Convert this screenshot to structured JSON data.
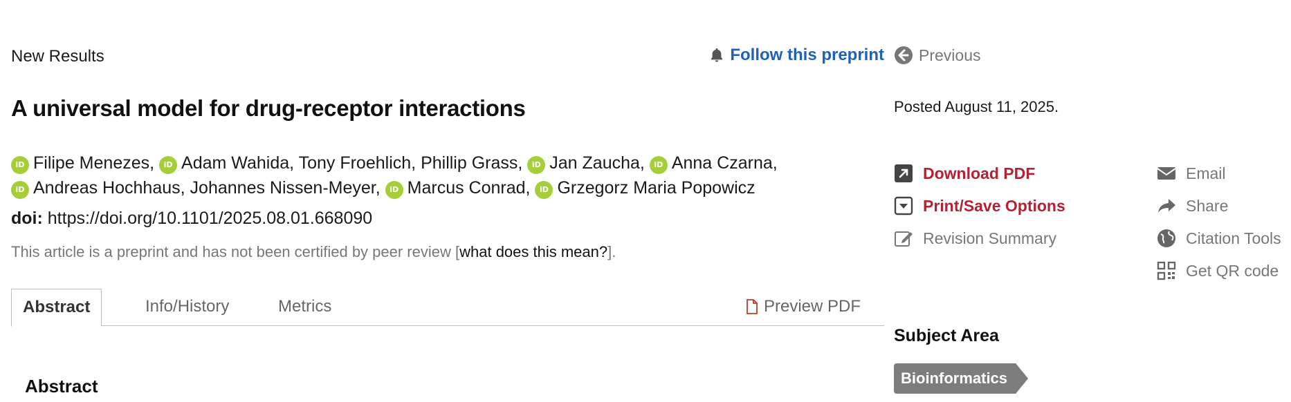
{
  "article": {
    "section_label": "New Results",
    "follow_label": "Follow this preprint",
    "title": "A universal model for drug-receptor interactions",
    "authors": [
      {
        "name": "Filipe Menezes,",
        "orcid": true
      },
      {
        "name": "Adam Wahida,",
        "orcid": true
      },
      {
        "name": "Tony Froehlich,",
        "orcid": false
      },
      {
        "name": "Phillip Grass,",
        "orcid": false
      },
      {
        "name": "Jan Zaucha,",
        "orcid": true
      },
      {
        "name": "Anna Czarna,",
        "orcid": true
      },
      {
        "name": "Andreas Hochhaus,",
        "orcid": true
      },
      {
        "name": "Johannes Nissen-Meyer,",
        "orcid": false
      },
      {
        "name": "Marcus Conrad,",
        "orcid": true
      },
      {
        "name": "Grzegorz Maria Popowicz",
        "orcid": true
      }
    ],
    "orcid_badge": "iD",
    "doi_label": "doi:",
    "doi_value": "https://doi.org/10.1101/2025.08.01.668090",
    "disclaimer_text": "This article is a preprint and has not been certified by peer review [",
    "disclaimer_link": "what does this mean?",
    "disclaimer_end": "]."
  },
  "tabs": [
    {
      "label": "Abstract",
      "active": true
    },
    {
      "label": "Info/History",
      "active": false
    },
    {
      "label": "Metrics",
      "active": false
    }
  ],
  "preview_pdf_label": "Preview PDF",
  "abstract_heading": "Abstract",
  "sidebar": {
    "previous_label": "Previous",
    "posted": "Posted August 11, 2025.",
    "actions_left": [
      {
        "label": "Download PDF",
        "icon": "external-link-icon",
        "style": "red"
      },
      {
        "label": "Print/Save Options",
        "icon": "print-save-icon",
        "style": "red"
      },
      {
        "label": "Revision Summary",
        "icon": "edit-icon",
        "style": "grey"
      }
    ],
    "actions_right": [
      {
        "label": "Email",
        "icon": "envelope-icon"
      },
      {
        "label": "Share",
        "icon": "share-icon"
      },
      {
        "label": "Citation Tools",
        "icon": "globe-icon"
      },
      {
        "label": "Get QR code",
        "icon": "qr-code-icon"
      }
    ],
    "subject_area_title": "Subject Area",
    "subject_tag": "Bioinformatics"
  },
  "colors": {
    "link_blue": "#1f61b8",
    "action_red": "#b32234",
    "orcid_green": "#a6ce39",
    "muted_grey": "#777777"
  }
}
